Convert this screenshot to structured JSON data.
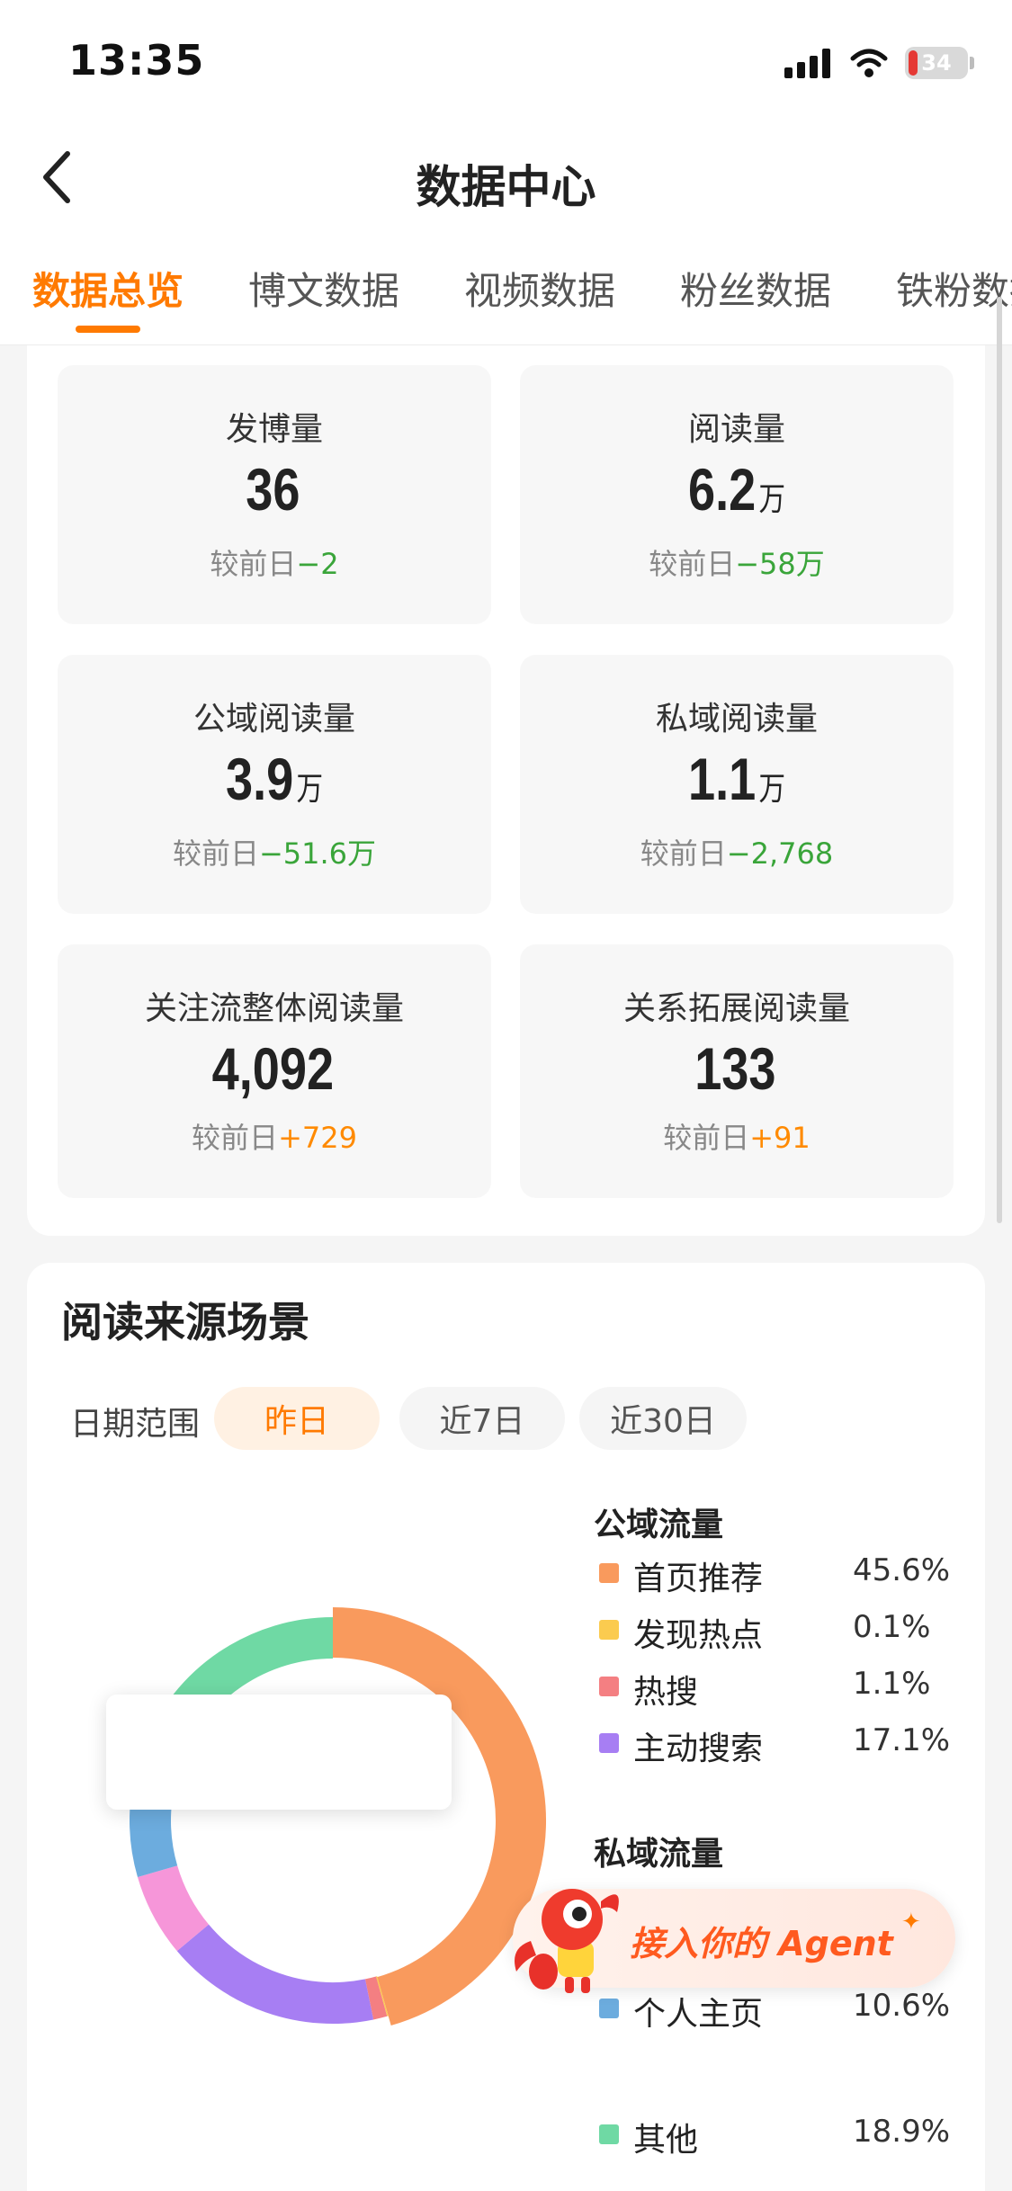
{
  "status_bar": {
    "time": "13:35",
    "battery": "34"
  },
  "nav": {
    "title": "数据中心"
  },
  "tabs": [
    {
      "label": "数据总览",
      "active": true
    },
    {
      "label": "博文数据"
    },
    {
      "label": "视频数据"
    },
    {
      "label": "粉丝数据"
    },
    {
      "label": "铁粉数据"
    }
  ],
  "stats": {
    "compare_label": "较前日",
    "items": [
      {
        "label": "发博量",
        "value": "36",
        "unit": "",
        "delta": "−2"
      },
      {
        "label": "阅读量",
        "value": "6.2",
        "unit": "万",
        "delta": "−58万"
      },
      {
        "label": "公域阅读量",
        "value": "3.9",
        "unit": "万",
        "delta": "−51.6万"
      },
      {
        "label": "私域阅读量",
        "value": "1.1",
        "unit": "万",
        "delta": "−2,768"
      },
      {
        "label": "关注流整体阅读量",
        "value": "4,092",
        "unit": "",
        "delta": "+729"
      },
      {
        "label": "关系拓展阅读量",
        "value": "133",
        "unit": "",
        "delta": "+91"
      }
    ]
  },
  "read_source": {
    "title": "阅读来源场景",
    "range_label": "日期范围",
    "ranges": [
      "昨日",
      "近7日",
      "近30日"
    ],
    "selected_range": "昨日"
  },
  "legend": {
    "public_title": "公域流量",
    "private_title": "私域流量",
    "public": [
      {
        "name": "首页推荐",
        "pct": "45.6%",
        "color": "#f99a5d"
      },
      {
        "name": "发现热点",
        "pct": "0.1%",
        "color": "#fbcb4f"
      },
      {
        "name": "热搜",
        "pct": "1.1%",
        "color": "#f47f82"
      },
      {
        "name": "主动搜索",
        "pct": "17.1%",
        "color": "#a77ef3"
      }
    ],
    "private": [
      {
        "name": "个人主页",
        "pct": "10.6%",
        "color": "#6cacde"
      },
      {
        "name": "其他",
        "pct": "18.9%",
        "color": "#6fd9a4"
      }
    ]
  },
  "chart_data": {
    "type": "pie",
    "title": "阅读来源场景",
    "slices": [
      {
        "label": "首页推荐",
        "value": 45.6,
        "color": "#f99a5d"
      },
      {
        "label": "发现热点",
        "value": 0.1,
        "color": "#fbcb4f"
      },
      {
        "label": "热搜",
        "value": 1.1,
        "color": "#f47f82"
      },
      {
        "label": "主动搜索",
        "value": 17.1,
        "color": "#a77ef3"
      },
      {
        "label": "",
        "value": 6.6,
        "color": "#f696d9"
      },
      {
        "label": "个人主页",
        "value": 10.6,
        "color": "#6cacde"
      },
      {
        "label": "其他",
        "value": 18.9,
        "color": "#6fd9a4"
      }
    ]
  },
  "agent_banner": {
    "text": "接入你的 Agent"
  },
  "colors": {
    "accent": "#ff7a00",
    "delta_down": "#3aa53a",
    "delta_up": "#ff8a00"
  }
}
